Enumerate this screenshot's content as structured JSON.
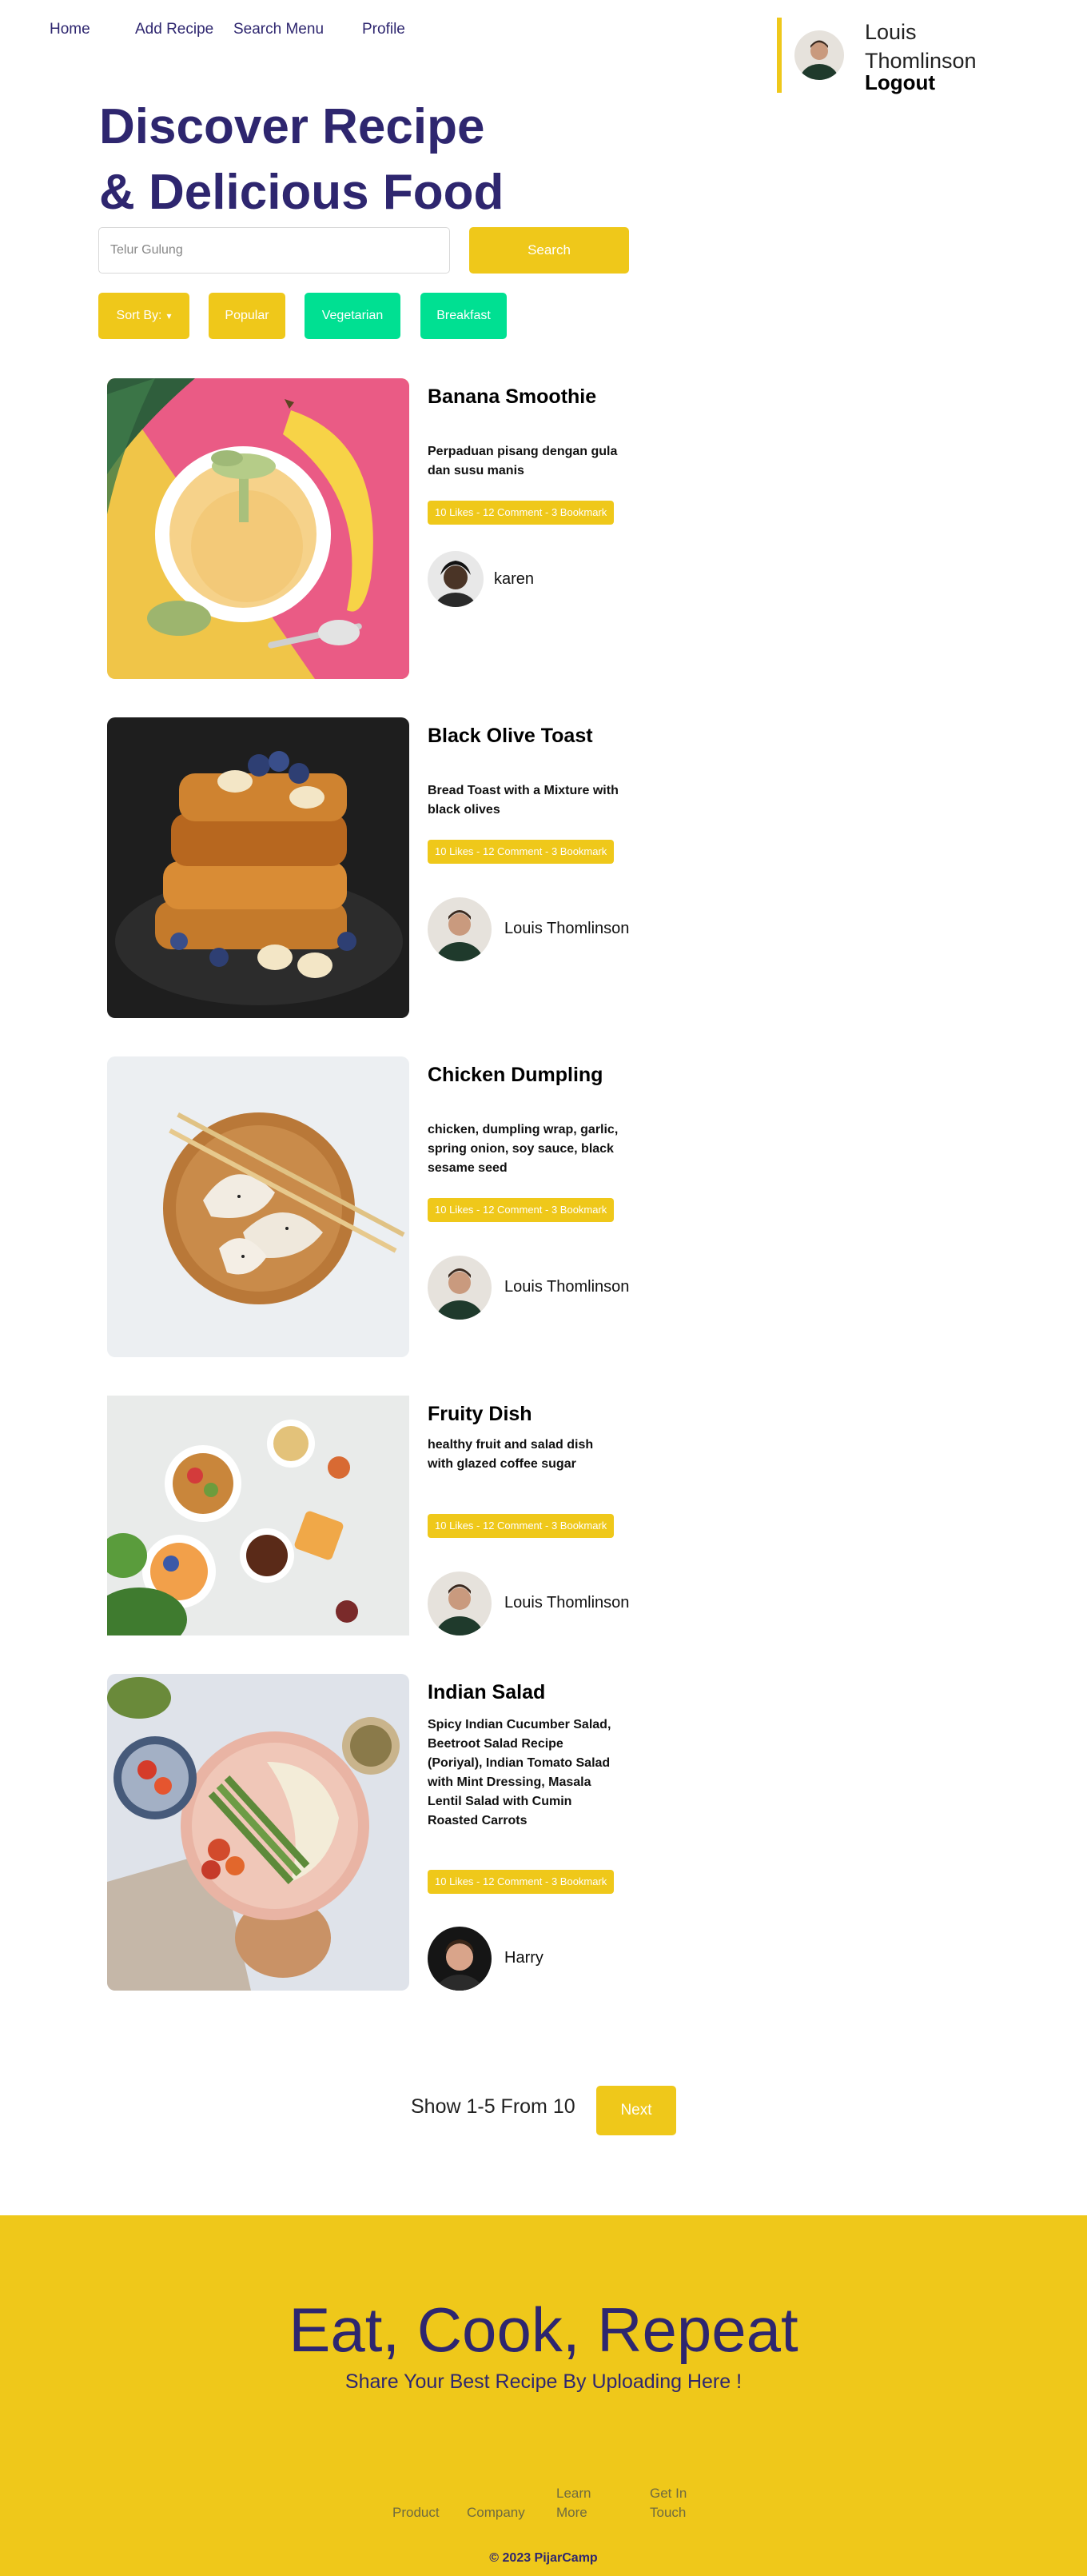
{
  "nav": {
    "home": "Home",
    "add_recipe": "Add Recipe",
    "search_menu": "Search Menu",
    "profile": "Profile"
  },
  "user": {
    "name": "Louis Thomlinson",
    "logout": "Logout"
  },
  "hero": {
    "title_line1": "Discover Recipe",
    "title_line2": "& Delicious Food",
    "search_placeholder": "Telur Gulung",
    "search_button": "Search"
  },
  "filters": {
    "sort_by": "Sort By:",
    "popular": "Popular",
    "vegetarian": "Vegetarian",
    "breakfast": "Breakfast"
  },
  "recipes": [
    {
      "title": "Banana Smoothie",
      "description": "Perpaduan pisang dengan gula dan susu manis",
      "stats": "10 Likes - 12 Comment - 3 Bookmark",
      "author": "karen"
    },
    {
      "title": "Black Olive Toast",
      "description": "Bread Toast with a Mixture with black olives",
      "stats": "10 Likes - 12 Comment - 3 Bookmark",
      "author": "Louis Thomlinson"
    },
    {
      "title": "Chicken Dumpling",
      "description": "chicken, dumpling wrap, garlic, spring onion, soy sauce, black sesame seed",
      "stats": "10 Likes - 12 Comment - 3 Bookmark",
      "author": "Louis Thomlinson"
    },
    {
      "title": "Fruity Dish",
      "description": "healthy fruit and salad dish with glazed coffee sugar",
      "stats": "10 Likes - 12 Comment - 3 Bookmark",
      "author": "Louis Thomlinson"
    },
    {
      "title": "Indian Salad",
      "description": "Spicy Indian Cucumber Salad, Beetroot Salad Recipe (Poriyal), Indian Tomato Salad with Mint Dressing, Masala Lentil Salad with Cumin Roasted Carrots",
      "stats": "10 Likes - 12 Comment - 3 Bookmark",
      "author": "Harry"
    }
  ],
  "pagination": {
    "info": "Show 1-5 From 10",
    "next": "Next"
  },
  "footer": {
    "title": "Eat, Cook, Repeat",
    "subtitle": "Share Your Best Recipe By Uploading Here !",
    "links": [
      "Product",
      "Company",
      "Learn More",
      "Get In Touch"
    ],
    "copyright": "© 2023 PijarCamp"
  },
  "colors": {
    "primary": "#2e266f",
    "accent": "#efc81a",
    "green": "#00e092"
  }
}
